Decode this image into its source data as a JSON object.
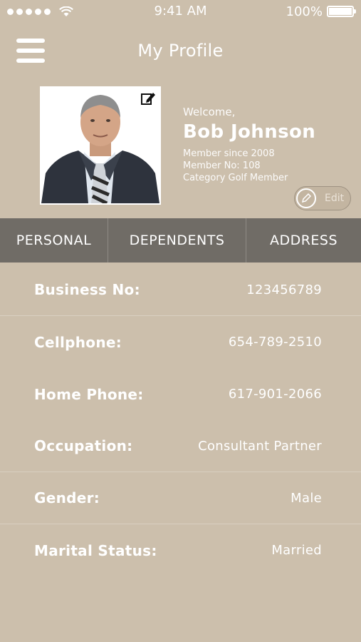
{
  "status_bar": {
    "time": "9:41 AM",
    "battery": "100%",
    "icons": [
      "signal-dots-icon",
      "wifi-icon",
      "battery-icon"
    ]
  },
  "nav": {
    "title": "My Profile",
    "menu_icon": "hamburger-menu-icon"
  },
  "profile": {
    "welcome": "Welcome,",
    "name": "Bob Johnson",
    "member_since": "Member since 2008",
    "member_no": "Member No: 108",
    "category": "Category Golf Member",
    "edit_label": "Edit",
    "photo_edit_icon": "pencil-square-icon",
    "edit_icon": "pencil-icon"
  },
  "tabs": [
    {
      "label": "PERSONAL"
    },
    {
      "label": "DEPENDENTS"
    },
    {
      "label": "ADDRESS"
    }
  ],
  "details": [
    {
      "label": "Business No:",
      "value": "123456789"
    },
    {
      "label": "Cellphone:",
      "value": "654-789-2510"
    },
    {
      "label": "Home Phone:",
      "value": "617-901-2066"
    },
    {
      "label": "Occupation:",
      "value": "Consultant Partner"
    },
    {
      "label": "Gender:",
      "value": "Male"
    },
    {
      "label": "Marital Status:",
      "value": "Married"
    }
  ],
  "colors": {
    "background": "#CCBFAC",
    "tab_bar": "#706C66",
    "text": "#FFFFFF"
  }
}
